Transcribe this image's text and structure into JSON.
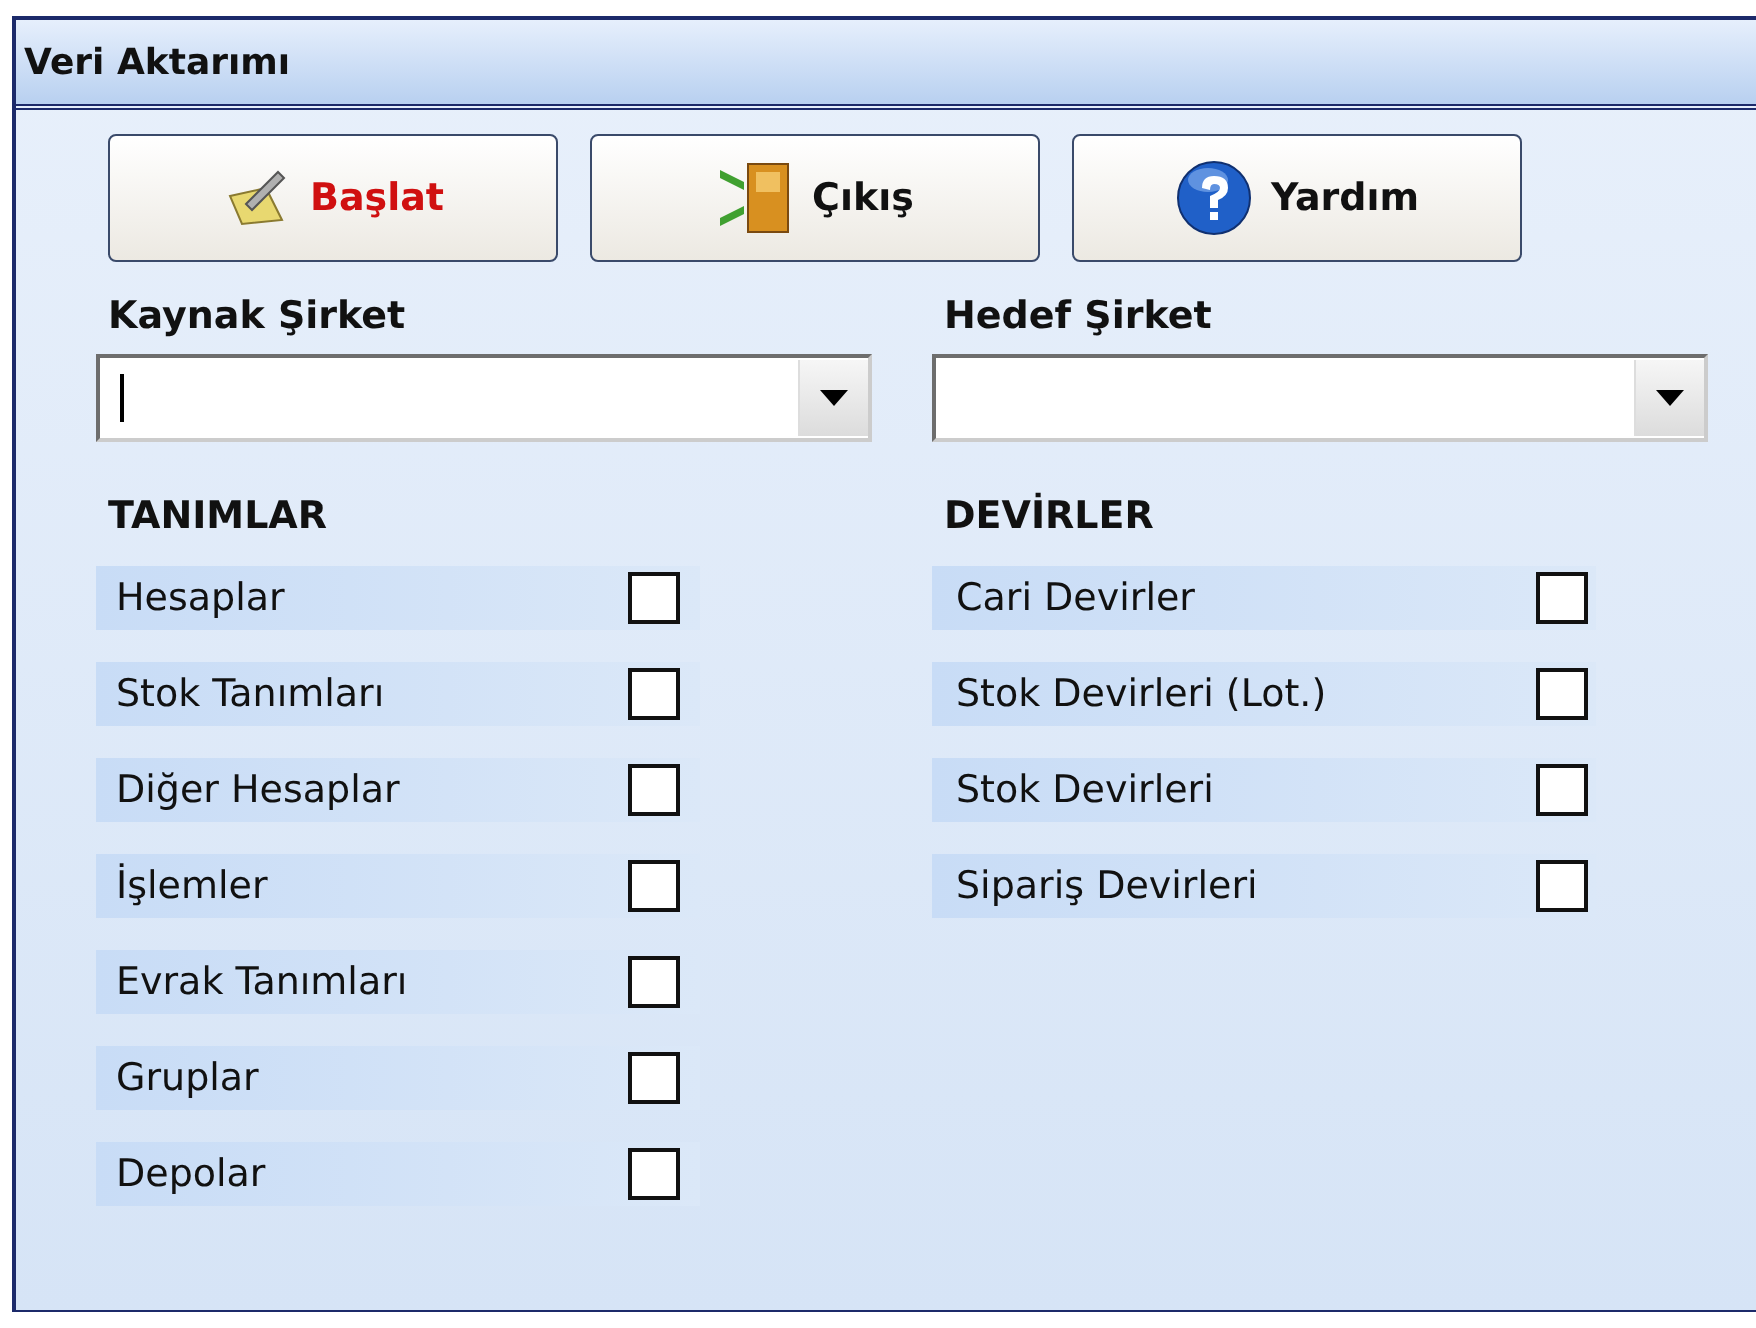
{
  "window": {
    "title": "Veri Aktarımı"
  },
  "buttons": [
    {
      "kind": "start",
      "label": "Başlat"
    },
    {
      "kind": "exit",
      "label": "Çıkış"
    },
    {
      "kind": "help",
      "label": "Yardım"
    }
  ],
  "companies": [
    {
      "label": "Kaynak Şirket",
      "focused": true
    },
    {
      "label": "Hedef Şirket",
      "focused": false
    }
  ],
  "groups": [
    {
      "title": "TANIMLAR",
      "items": [
        {
          "label": "Hesaplar",
          "checked": false
        },
        {
          "label": "Stok Tanımları",
          "checked": false
        },
        {
          "label": "Diğer Hesaplar",
          "checked": false
        },
        {
          "label": "İşlemler",
          "checked": false
        },
        {
          "label": "Evrak Tanımları",
          "checked": false
        },
        {
          "label": "Gruplar",
          "checked": false
        },
        {
          "label": "Depolar",
          "checked": false
        }
      ]
    },
    {
      "title": "DEVİRLER",
      "items": [
        {
          "label": "Cari Devirler",
          "checked": false
        },
        {
          "label": "Stok Devirleri (Lot.)",
          "checked": false
        },
        {
          "label": "Stok Devirleri",
          "checked": false
        },
        {
          "label": "Sipariş Devirleri",
          "checked": false
        }
      ]
    }
  ]
}
